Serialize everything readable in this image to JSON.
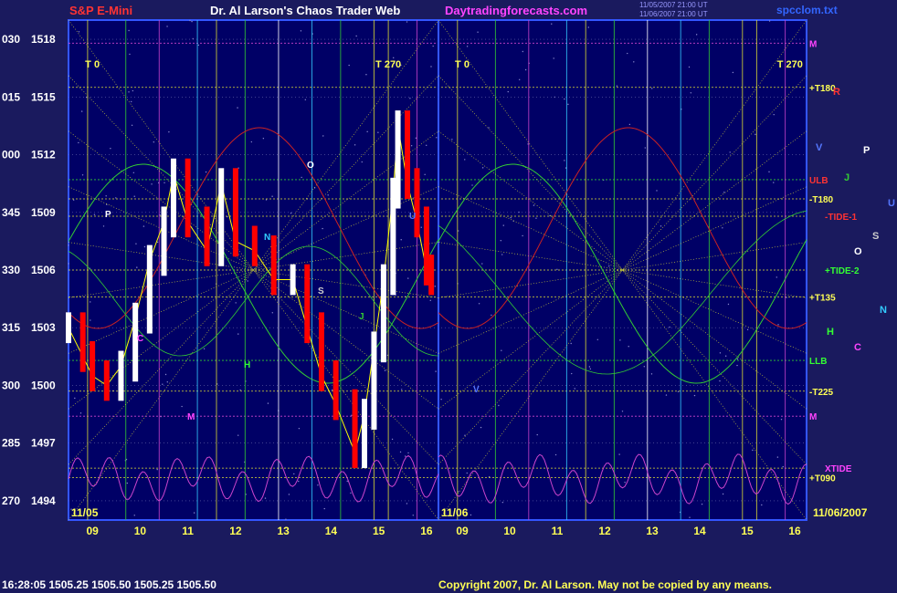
{
  "header": {
    "left": "S&P E-Mini",
    "center": "Dr. Al Larson's Chaos Trader Web",
    "site": "Daytradingforecasts.com",
    "stamp1": "11/05/2007 21:00 UT",
    "stamp2": "11/06/2007 21:00 UT",
    "file": "spcclom.txt"
  },
  "footer": {
    "quote": "16:28:05  1505.25  1505.50  1505.25  1505.50",
    "copyright": "Copyright 2007, Dr. Al Larson. May not be copied by any means."
  },
  "colors": {
    "background": "#1a1a5e",
    "plot_border": "#3355ff",
    "price_up": "#ffffff",
    "price_down": "#ff0000",
    "xtide": "#cc44cc",
    "header_red": "#ff3333",
    "header_yellow": "#ffff55",
    "header_magenta": "#ff44ff"
  },
  "chart_data": {
    "type": "line",
    "title": "S&P E-Mini",
    "y_axis_labels": [
      {
        "code": "030",
        "price": 1518
      },
      {
        "code": "015",
        "price": 1515
      },
      {
        "code": "000",
        "price": 1512
      },
      {
        "code": "345",
        "price": 1509
      },
      {
        "code": "330",
        "price": 1506
      },
      {
        "code": "315",
        "price": 1503
      },
      {
        "code": "300",
        "price": 1500
      },
      {
        "code": "285",
        "price": 1497
      },
      {
        "code": "270",
        "price": 1494
      }
    ],
    "ylim": [
      1494,
      1519
    ],
    "x_tick_labels_day1": [
      "09",
      "10",
      "11",
      "12",
      "13",
      "14",
      "15",
      "16"
    ],
    "x_tick_labels_day2": [
      "09",
      "10",
      "11",
      "12",
      "13",
      "14",
      "15",
      "16"
    ],
    "date_labels": [
      "11/05",
      "11/06",
      "11/06/2007"
    ],
    "price_series_day1": [
      {
        "hour": 8.5,
        "price": 1503.0
      },
      {
        "hour": 8.8,
        "price": 1501.5
      },
      {
        "hour": 9.0,
        "price": 1500.5
      },
      {
        "hour": 9.3,
        "price": 1500.0
      },
      {
        "hour": 9.6,
        "price": 1501.0
      },
      {
        "hour": 9.9,
        "price": 1503.5
      },
      {
        "hour": 10.2,
        "price": 1506.5
      },
      {
        "hour": 10.5,
        "price": 1508.5
      },
      {
        "hour": 10.7,
        "price": 1511.0
      },
      {
        "hour": 11.0,
        "price": 1508.5
      },
      {
        "hour": 11.4,
        "price": 1507.0
      },
      {
        "hour": 11.7,
        "price": 1510.5
      },
      {
        "hour": 12.0,
        "price": 1507.5
      },
      {
        "hour": 12.4,
        "price": 1507.0
      },
      {
        "hour": 12.8,
        "price": 1505.5
      },
      {
        "hour": 13.2,
        "price": 1505.5
      },
      {
        "hour": 13.5,
        "price": 1503.0
      },
      {
        "hour": 13.8,
        "price": 1500.5
      },
      {
        "hour": 14.1,
        "price": 1499.0
      },
      {
        "hour": 14.5,
        "price": 1496.5
      },
      {
        "hour": 14.7,
        "price": 1498.5
      },
      {
        "hour": 14.9,
        "price": 1502.0
      },
      {
        "hour": 15.1,
        "price": 1505.5
      },
      {
        "hour": 15.3,
        "price": 1510.0
      },
      {
        "hour": 15.4,
        "price": 1513.5
      },
      {
        "hour": 15.6,
        "price": 1510.5
      },
      {
        "hour": 15.8,
        "price": 1508.5
      },
      {
        "hour": 16.0,
        "price": 1506.0
      },
      {
        "hour": 16.1,
        "price": 1505.5
      }
    ],
    "lines": [
      {
        "label": "M",
        "price": 1517.8
      },
      {
        "label": "+T180",
        "price": 1515.5
      },
      {
        "label": "ULB",
        "price": 1510.7
      },
      {
        "label": "-T180",
        "price": 1509.7
      },
      {
        "label": "-TIDE-1",
        "price": 1508.8
      },
      {
        "label": "+TIDE-2",
        "price": 1506.0
      },
      {
        "label": "+T135",
        "price": 1504.6
      },
      {
        "label": "LLB",
        "price": 1501.3
      },
      {
        "label": "-T225",
        "price": 1499.7
      },
      {
        "label": "M",
        "price": 1498.4
      },
      {
        "label": "XTIDE",
        "price": 1495.7
      },
      {
        "label": "+T090",
        "price": 1495.2
      }
    ],
    "planet_markers": [
      {
        "label": "R",
        "color": "#ff3333"
      },
      {
        "label": "V",
        "color": "#5577ff"
      },
      {
        "label": "P",
        "color": "#ffffff"
      },
      {
        "label": "J",
        "color": "#33cc33"
      },
      {
        "label": "U",
        "color": "#5577ff"
      },
      {
        "label": "S",
        "color": "#cccccc"
      },
      {
        "label": "O",
        "color": "#ffffff"
      },
      {
        "label": "N",
        "color": "#33ccff"
      },
      {
        "label": "H",
        "color": "#33ff33"
      },
      {
        "label": "C",
        "color": "#ff44ff"
      }
    ],
    "time_labels": [
      "T 0",
      "T 270",
      "T 0",
      "T 270"
    ],
    "in_plot_labels": [
      "P",
      "O",
      "S",
      "N",
      "H",
      "M",
      "C",
      "J",
      "U",
      "V"
    ]
  }
}
